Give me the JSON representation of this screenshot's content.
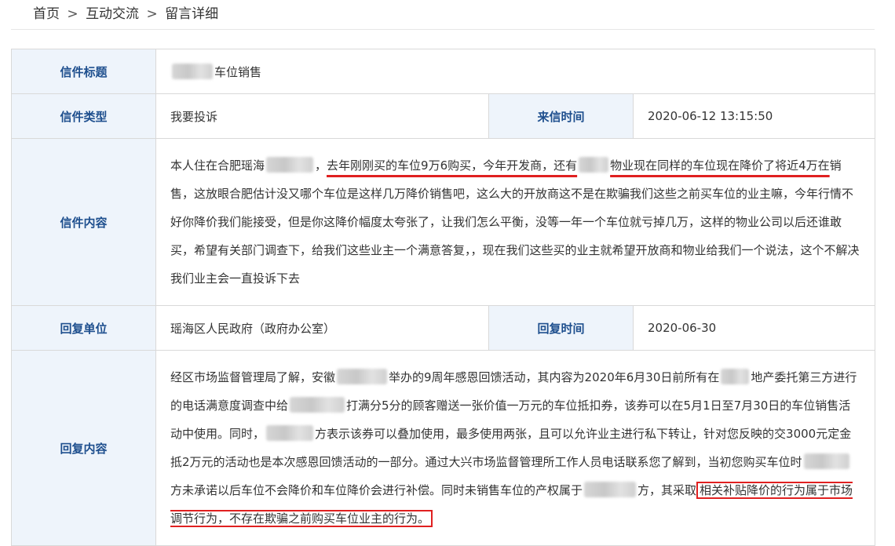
{
  "breadcrumb": {
    "home": "首页",
    "sep": ">",
    "section": "互动交流",
    "current": "留言详细"
  },
  "letter": {
    "title_label": "信件标题",
    "title_value": "车位销售",
    "type_label": "信件类型",
    "type_value": "我要投诉",
    "time_label": "来信时间",
    "time_value": "2020-06-12 13:15:50",
    "content_label": "信件内容",
    "content": {
      "p1": "本人住在合肥瑶海",
      "p2": "，",
      "p3_underlined": "去年刚刚买的车位9万6购买，今年开发商，还有",
      "p4_underlined": "物业现在同样的车位现在降价了将近4万在",
      "p5": "销售，这放眼合肥估计没又哪个车位是这样几万降价销售吧，这么大的开放商这不是在欺骗我们这些之前买车位的业主嘛，今年行情不好你降价我们能接受，但是你这降价幅度太夸张了，让我们怎么平衡，没等一年一个车位就亏掉几万，这样的物业公司以后还谁敢买，希望有关部门调查下，给我们这些业主一个满意答复，，现在我们这些买的业主就希望开放商和物业给我们一个说法，这个不解决我们业主会一直投诉下去"
    }
  },
  "reply": {
    "unit_label": "回复单位",
    "unit_value": "瑶海区人民政府（政府办公室）",
    "time_label": "回复时间",
    "time_value": "2020-06-30",
    "content_label": "回复内容",
    "content": {
      "r1": "经区市场监督管理局了解，安徽",
      "r2": "举办的9周年感恩回馈活动，其内容为2020年6月30日前所有在",
      "r3": "地产委托第三方进行的电话满意度调查中给",
      "r4": "打满分5分的顾客赠送一张价值一万元的车位抵扣券，该券可以在5月1日至7月30日的车位销售活动中使用。同时，",
      "r5": "方表示该券可以叠加使用，最多使用两张，且可以允许业主进行私下转让，针对您反映的交3000元定金抵2万元的活动也是本次感恩回馈活动的一部分。通过大兴市场监督管理所工作人员电话联系您了解到，当初您购买车位时",
      "r6": "方未承诺以后车位不会降价和车位降价会进行补偿。同时未销售车位的产权属于",
      "r7": "方，其采取",
      "r8_boxed": "相关补贴降价的行为属于市场调节行为，不存在欺骗之前购买车位业主的行为。"
    }
  }
}
